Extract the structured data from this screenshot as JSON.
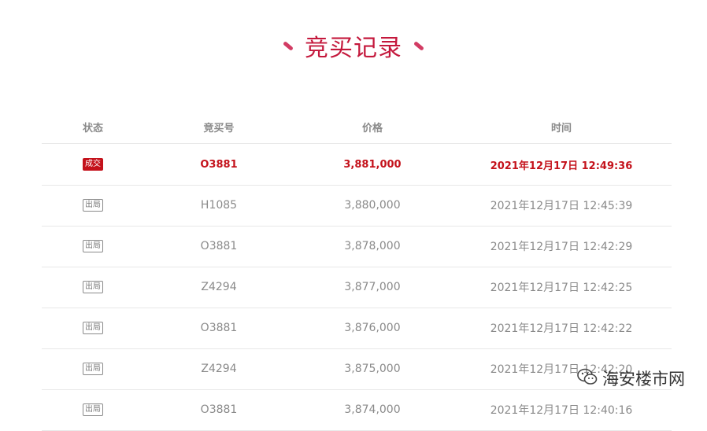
{
  "title": "竞买记录",
  "header": {
    "status": "状态",
    "bid_no": "竞买号",
    "price": "价格",
    "time": "时间"
  },
  "rows": [
    {
      "status": "成交",
      "bid_no": "O3881",
      "price": "3,881,000",
      "time": "2021年12月17日 12:49:36"
    },
    {
      "status": "出局",
      "bid_no": "H1085",
      "price": "3,880,000",
      "time": "2021年12月17日 12:45:39"
    },
    {
      "status": "出局",
      "bid_no": "O3881",
      "price": "3,878,000",
      "time": "2021年12月17日 12:42:29"
    },
    {
      "status": "出局",
      "bid_no": "Z4294",
      "price": "3,877,000",
      "time": "2021年12月17日 12:42:25"
    },
    {
      "status": "出局",
      "bid_no": "O3881",
      "price": "3,876,000",
      "time": "2021年12月17日 12:42:22"
    },
    {
      "status": "出局",
      "bid_no": "Z4294",
      "price": "3,875,000",
      "time": "2021年12月17日 12:42:20"
    },
    {
      "status": "出局",
      "bid_no": "O3881",
      "price": "3,874,000",
      "time": "2021年12月17日 12:40:16"
    }
  ],
  "watermark": {
    "text": "海安楼市网",
    "icon": "wechat-icon"
  },
  "colors": {
    "accent": "#c4183c",
    "win": "#c4121b",
    "muted": "#8a8a8a",
    "divider": "#e8e8e8"
  }
}
